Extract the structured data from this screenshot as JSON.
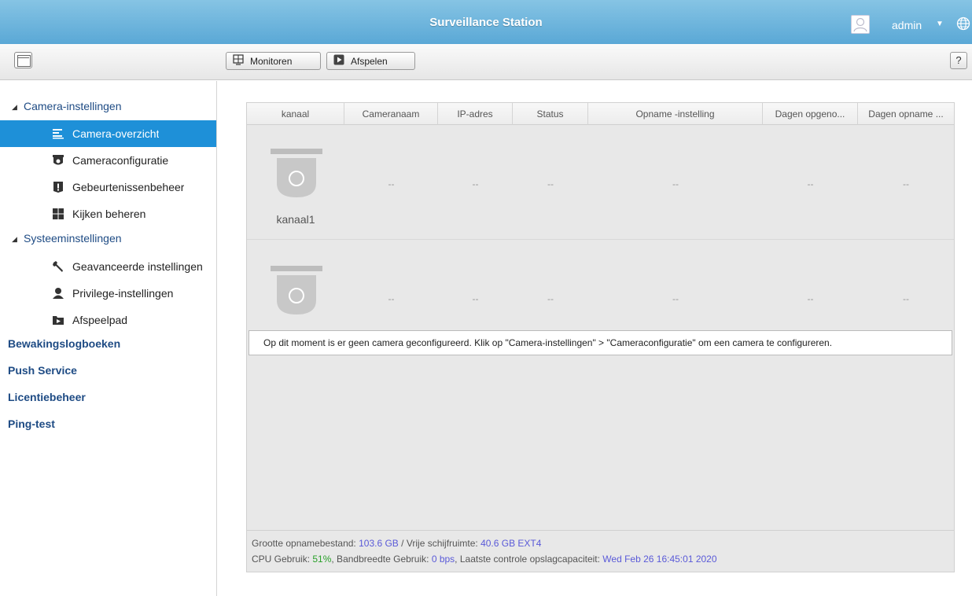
{
  "window": {
    "title": "Surveillance Station",
    "user": "admin"
  },
  "toolbar": {
    "monitor_label": "Monitoren",
    "playback_label": "Afspelen",
    "help_label": "?"
  },
  "sidebar": {
    "camera_group": "Camera-instellingen",
    "camera_items": [
      {
        "label": "Camera-overzicht",
        "icon": "list-icon",
        "active": true
      },
      {
        "label": "Cameraconfiguratie",
        "icon": "camera-icon"
      },
      {
        "label": "Gebeurtenissenbeheer",
        "icon": "alert-icon"
      },
      {
        "label": "Kijken beheren",
        "icon": "grid-icon"
      }
    ],
    "system_group": "Systeeminstellingen",
    "system_items": [
      {
        "label": "Geavanceerde instellingen",
        "icon": "wrench-icon"
      },
      {
        "label": "Privilege-instellingen",
        "icon": "user-icon"
      },
      {
        "label": "Afspeelpad",
        "icon": "folder-play-icon"
      }
    ],
    "links": [
      "Bewakingslogboeken",
      "Push Service",
      "Licentiebeheer",
      "Ping-test"
    ]
  },
  "table": {
    "columns": [
      "kanaal",
      "Cameranaam",
      "IP-adres",
      "Status",
      "Opname -instelling",
      "Dagen opgeno...",
      "Dagen opname ..."
    ],
    "rows": [
      {
        "channel": "kanaal1",
        "cells": [
          "--",
          "--",
          "--",
          "--",
          "--",
          "--"
        ]
      },
      {
        "channel": "",
        "cells": [
          "--",
          "--",
          "--",
          "--",
          "--",
          "--"
        ]
      }
    ],
    "message": "Op dit moment is er geen camera geconfigureerd. Klik op \"Camera-instellingen\" > \"Cameraconfiguratie\" om een camera te configureren."
  },
  "footer": {
    "line1": {
      "size_label": "Grootte opnamebestand: ",
      "size_value": "103.6 GB",
      "sep": " / ",
      "free_label": "Vrije schijfruimte: ",
      "free_value": "40.6 GB EXT4"
    },
    "line2": {
      "cpu_label": "CPU Gebruik: ",
      "cpu_value": "51%",
      "bw_label": ", Bandbreedte Gebruik: ",
      "bw_value": "0 bps",
      "check_label": ", Laatste controle opslagcapaciteit: ",
      "check_value": "Wed Feb 26 16:45:01 2020"
    }
  }
}
